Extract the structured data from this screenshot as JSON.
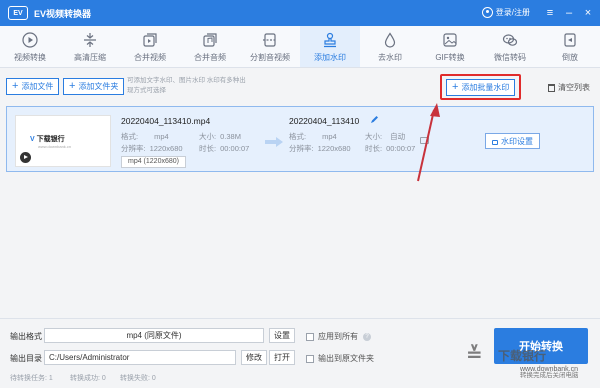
{
  "window": {
    "logo_text": "EV",
    "title": "EV视频转换器",
    "user_label": "登录/注册",
    "menu_icon": "hamburger-icon",
    "minimize_icon": "minimize-icon",
    "close_icon": "close-icon"
  },
  "toolbar": {
    "active": "添加水印",
    "items": [
      {
        "label": "视频转换",
        "icon": "video-convert-icon"
      },
      {
        "label": "高清压缩",
        "icon": "compress-icon"
      },
      {
        "label": "合并视频",
        "icon": "merge-video-icon"
      },
      {
        "label": "合并音频",
        "icon": "merge-audio-icon"
      },
      {
        "label": "分割音视频",
        "icon": "split-icon"
      },
      {
        "label": "添加水印",
        "icon": "stamp-icon"
      },
      {
        "label": "去水印",
        "icon": "remove-watermark-icon"
      },
      {
        "label": "GIF转换",
        "icon": "gif-icon"
      },
      {
        "label": "微信转码",
        "icon": "wechat-icon"
      },
      {
        "label": "倒放",
        "icon": "reverse-icon"
      }
    ]
  },
  "actions": {
    "add_file": "添加文件",
    "add_folder": "添加文件夹",
    "hint": "可添加文字水印、图片水印 水印有多种出现方式可选择",
    "batch_watermark": "添加批量水印",
    "clear_list": "清空列表"
  },
  "file": {
    "thumb_logo_mark": "V",
    "thumb_logo_text": "下载银行",
    "thumb_sub": "www.downbank.cn",
    "name": "20220404_113410.mp4",
    "format_label": "格式:",
    "format": "mp4",
    "size_label": "大小:",
    "size": "0.38M",
    "resolution_label": "分辨率:",
    "resolution": "1220x680",
    "duration_label": "时长:",
    "duration": "00:00:07",
    "format_tag": "mp4 (1220x680)",
    "output_name": "20220404_113410",
    "out_format": "mp4",
    "out_size": "自动",
    "out_resolution": "1220x680",
    "out_duration": "00:00:07",
    "watermark_settings": "水印设置"
  },
  "bottom": {
    "output_format_label": "输出格式",
    "output_format_value": "mp4 (同原文件)",
    "settings": "设置",
    "apply_all": "应用到所有",
    "output_dir_label": "输出目录",
    "output_dir_value": "C:/Users/Administrator",
    "modify": "修改",
    "open": "打开",
    "output_to_source": "输出到原文件夹",
    "start": "开始转换",
    "pending": "待转换任务:  1",
    "success": "转换成功:  0",
    "failed": "转换失败:  0",
    "right_status": "转换完成后关闭电脑"
  },
  "watermark": {
    "mark": "≚",
    "text": "下载银行",
    "url": "www.downbank.cn"
  },
  "colors": {
    "accent": "#2b7de0",
    "highlight": "#e02b2b"
  }
}
